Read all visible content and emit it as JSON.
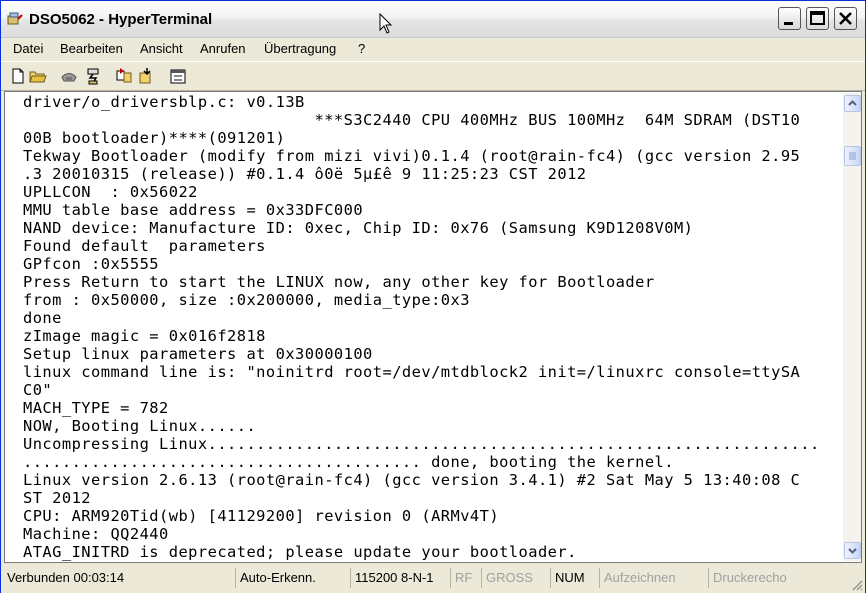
{
  "window": {
    "title": "DSO5062 - HyperTerminal"
  },
  "menu": [
    {
      "label": "Datei"
    },
    {
      "label": "Bearbeiten"
    },
    {
      "label": "Ansicht"
    },
    {
      "label": "Anrufen"
    },
    {
      "label": "Übertragung"
    },
    {
      "label": "?"
    }
  ],
  "toolbar": {
    "icons": [
      "new-icon",
      "open-icon",
      "call-icon",
      "disconnect-icon",
      "send-icon",
      "receive-icon",
      "properties-icon"
    ]
  },
  "terminal": {
    "lines": [
      "driver/o_driversblp.c: v0.13B",
      "                              ***S3C2440 CPU 400MHz BUS 100MHz  64M SDRAM (DST10",
      "00B bootloader)****(091201)",
      "Tekway Bootloader (modify from mizi vivi)0.1.4 (root@rain-fc4) (gcc version 2.95",
      ".3 20010315 (release)) #0.1.4 ô0ë 5µ£ê 9 11:25:23 CST 2012",
      "UPLLCON  : 0x56022",
      "MMU table base address = 0x33DFC000",
      "NAND device: Manufacture ID: 0xec, Chip ID: 0x76 (Samsung K9D1208V0M)",
      "Found default  parameters",
      "GPfcon :0x5555",
      "Press Return to start the LINUX now, any other key for Bootloader",
      "from : 0x50000, size :0x200000, media_type:0x3",
      "done",
      "zImage magic = 0x016f2818",
      "Setup linux parameters at 0x30000100",
      "linux command line is: \"noinitrd root=/dev/mtdblock2 init=/linuxrc console=ttySA",
      "C0\"",
      "MACH_TYPE = 782",
      "NOW, Booting Linux......",
      "Uncompressing Linux...............................................................",
      "......................................... done, booting the kernel.",
      "Linux version 2.6.13 (root@rain-fc4) (gcc version 3.4.1) #2 Sat May 5 13:40:08 C",
      "ST 2012",
      "CPU: ARM920Tid(wb) [41129200] revision 0 (ARMv4T)",
      "Machine: QQ2440",
      "ATAG_INITRD is deprecated; please update your bootloader."
    ]
  },
  "statusbar": {
    "connected": "Verbunden 00:03:14",
    "detect": "Auto-Erkenn.",
    "settings": "115200 8-N-1",
    "rf": "RF",
    "caps": "GROSS",
    "num": "NUM",
    "record": "Aufzeichnen",
    "print_echo": "Druckerecho"
  }
}
